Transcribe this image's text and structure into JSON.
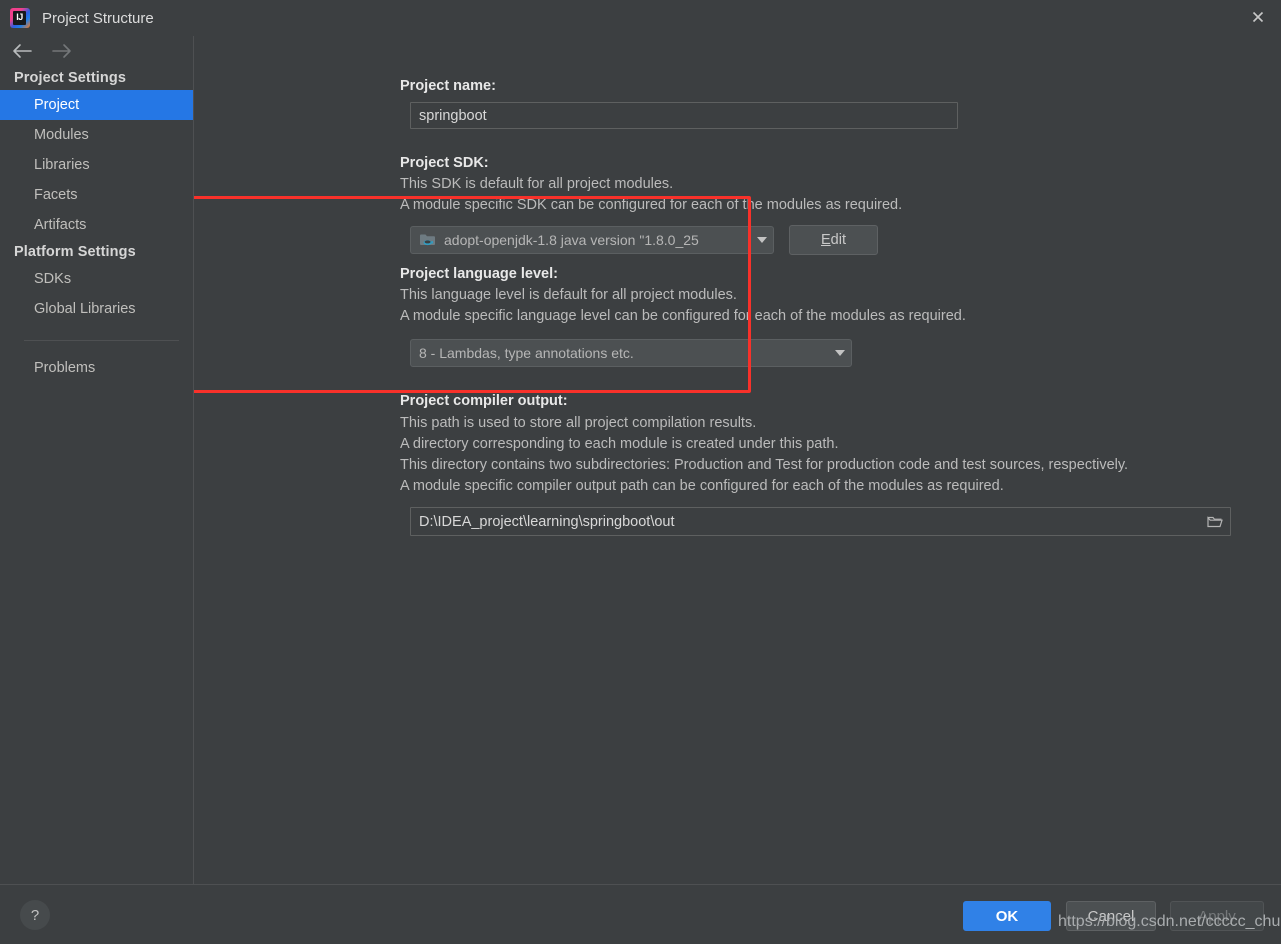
{
  "window": {
    "title": "Project Structure",
    "app_icon": "intellij-idea-logo",
    "logo_text": "IJ",
    "close_icon": "close-icon"
  },
  "nav": {
    "back_icon": "arrow-left-icon",
    "forward_icon": "arrow-right-icon"
  },
  "sidebar": {
    "groups": [
      {
        "label": "Project Settings",
        "items": [
          {
            "label": "Project",
            "selected": true
          },
          {
            "label": "Modules",
            "selected": false
          },
          {
            "label": "Libraries",
            "selected": false
          },
          {
            "label": "Facets",
            "selected": false
          },
          {
            "label": "Artifacts",
            "selected": false
          }
        ]
      },
      {
        "label": "Platform Settings",
        "items": [
          {
            "label": "SDKs",
            "selected": false
          },
          {
            "label": "Global Libraries",
            "selected": false
          }
        ]
      }
    ],
    "extra_items": [
      {
        "label": "Problems",
        "selected": false
      }
    ]
  },
  "main": {
    "project_name": {
      "label": "Project name:",
      "value": "springboot",
      "placeholder": ""
    },
    "project_sdk": {
      "label": "Project SDK:",
      "desc_line1": "This SDK is default for all project modules.",
      "desc_line2": "A module specific SDK can be configured for each of the modules as required.",
      "selected": "adopt-openjdk-1.8 java version \"1.8.0_25",
      "sdk_icon": "java-sdk-folder-icon",
      "dropdown_icon": "chevron-down-icon",
      "edit_button": "Edit",
      "edit_mnemonic": "E",
      "edit_rest": "dit"
    },
    "language_level": {
      "label": "Project language level:",
      "desc_line1": "This language level is default for all project modules.",
      "desc_line2": "A module specific language level can be configured for each of the modules as required.",
      "selected": "8 - Lambdas, type annotations etc.",
      "dropdown_icon": "chevron-down-icon"
    },
    "compiler_output": {
      "label": "Project compiler output:",
      "desc_line1": "This path is used to store all project compilation results.",
      "desc_line2": "A directory corresponding to each module is created under this path.",
      "desc_line3": "This directory contains two subdirectories: Production and Test for production code and test sources, respectively.",
      "desc_line4": "A module specific compiler output path can be configured for each of the modules as required.",
      "value": "D:\\IDEA_project\\learning\\springboot\\out",
      "placeholder": "",
      "browse_icon": "folder-open-icon"
    }
  },
  "annotation": {
    "color": "#f8312a",
    "shape": "rectangle-highlight"
  },
  "footer": {
    "help_button": "?",
    "help_icon": "question-mark-icon",
    "ok_button": "OK",
    "cancel_button": "Cancel",
    "apply_button": "Apply",
    "apply_disabled": true
  },
  "overlay": {
    "watermark": "https://blog.csdn.net/ccccc_chuang"
  },
  "colors": {
    "accent": "#2577e5",
    "primary_button": "#3081e7",
    "annotation": "#f8312a",
    "window_bg": "#3c3f41",
    "control_bg": "#4c5052"
  }
}
